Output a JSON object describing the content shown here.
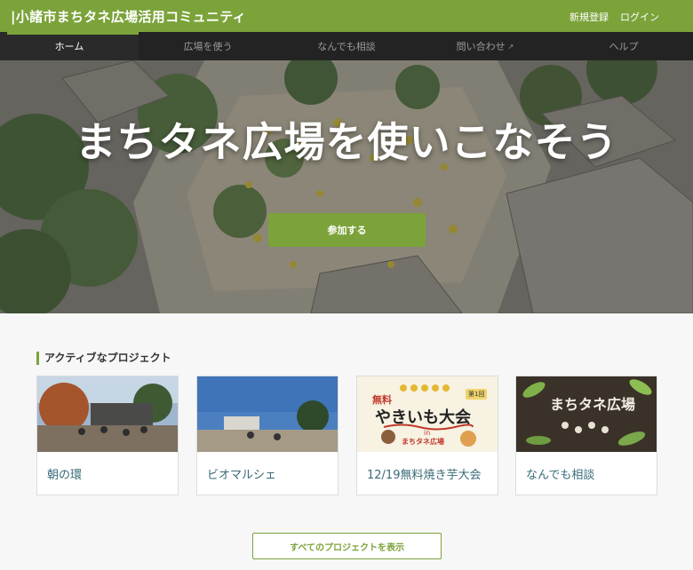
{
  "header": {
    "site_title": "|小諸市まちタネ広場活用コミュニティ",
    "signup": "新規登録",
    "login": "ログイン"
  },
  "nav": {
    "items": [
      {
        "label": "ホーム"
      },
      {
        "label": "広場を使う"
      },
      {
        "label": "なんでも相談"
      },
      {
        "label": "問い合わせ"
      },
      {
        "label": "ヘルプ"
      }
    ]
  },
  "hero": {
    "title": "まちタネ広場を使いこなそう",
    "join_button": "参加する"
  },
  "projects": {
    "heading": "アクティブなプロジェクト",
    "cards": [
      {
        "title": "朝の環"
      },
      {
        "title": "ビオマルシェ"
      },
      {
        "title": "12/19無料焼き芋大会",
        "poster": {
          "free": "無料",
          "main": "やきいも大会",
          "badge": "第1回",
          "in": "in",
          "venue": "まちタネ広場"
        }
      },
      {
        "title": "なんでも相談",
        "image_text": "まちタネ広場"
      }
    ],
    "view_all": "すべてのプロジェクトを表示"
  },
  "colors": {
    "brand_green": "#7ba33a",
    "nav_dark": "#232323",
    "card_title": "#3a6a78"
  }
}
